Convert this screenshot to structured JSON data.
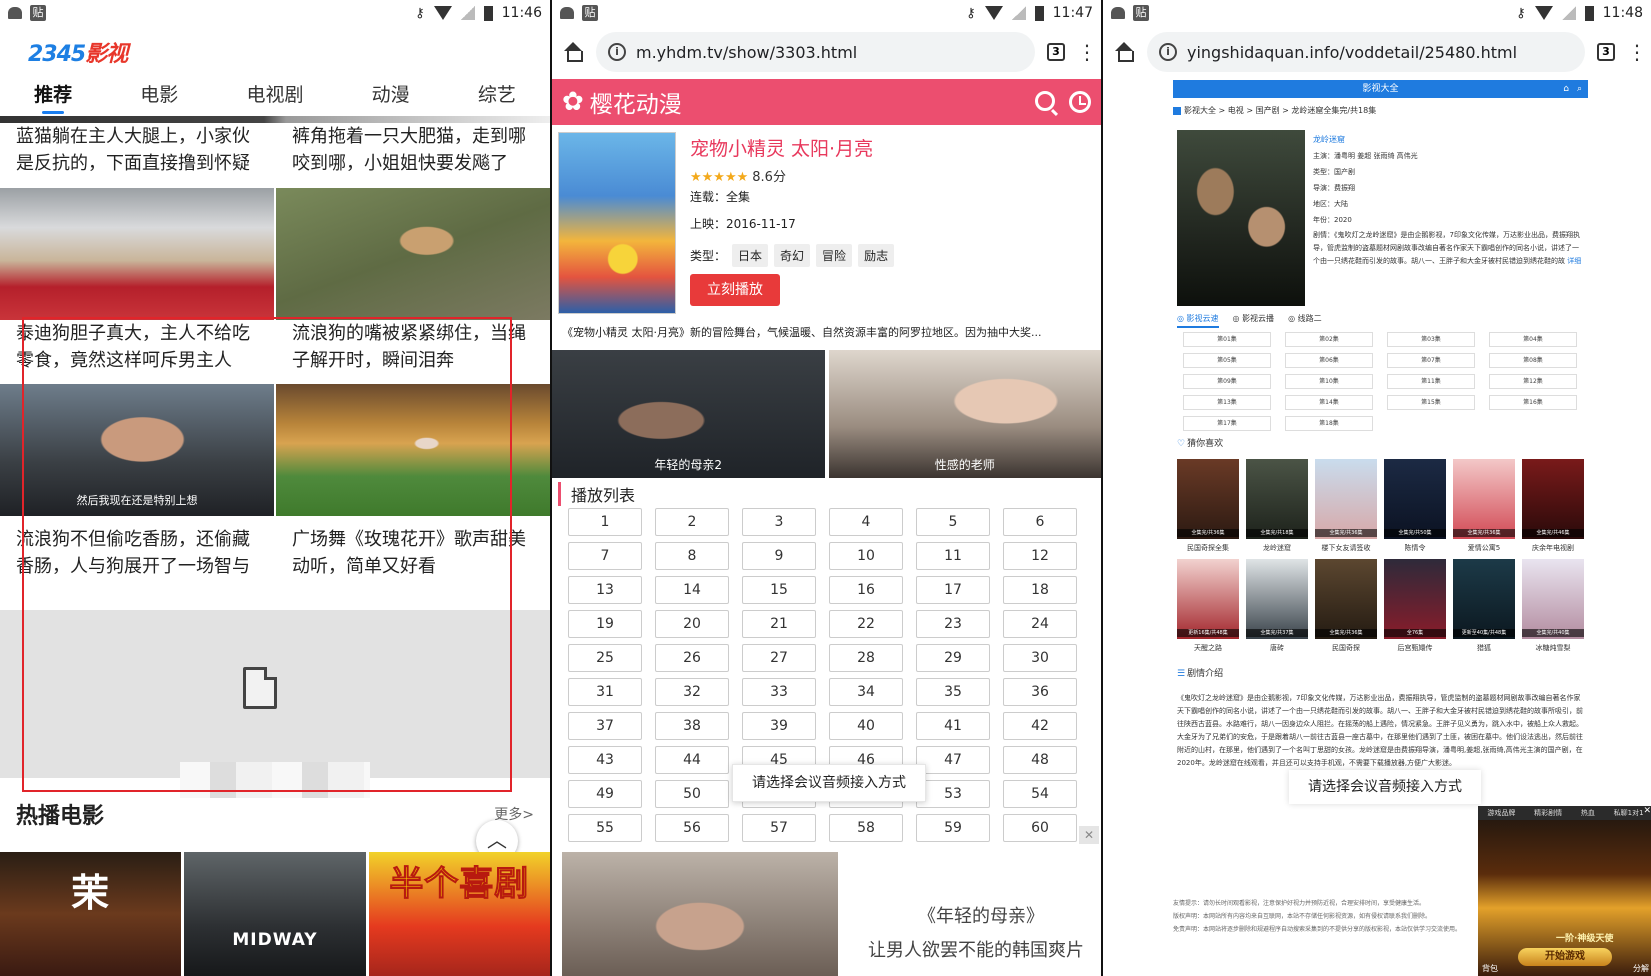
{
  "screen1": {
    "status": {
      "time": "11:46",
      "app_badge": "贴"
    },
    "logo": {
      "digits": "2345",
      "text": "影视"
    },
    "tabs": [
      {
        "label": "推荐",
        "active": true
      },
      {
        "label": "电影",
        "active": false
      },
      {
        "label": "电视剧",
        "active": false
      },
      {
        "label": "动漫",
        "active": false
      },
      {
        "label": "综艺",
        "active": false
      }
    ],
    "feed": [
      {
        "title": "蓝猫躺在主人大腿上，小家伙是反抗的，下面直接撸到怀疑"
      },
      {
        "title": "裤角拖着一只大肥猫，走到哪咬到哪，小姐姐快要发飚了"
      },
      {
        "title": "泰迪狗胆子真大，主人不给吃零食，竟然这样呵斥男主人"
      },
      {
        "title": "流浪狗的嘴被紧紧绑住，当绳子解开时，瞬间泪奔"
      },
      {
        "title": "流浪狗不但偷吃香肠，还偷藏香肠，人与狗展开了一场智与",
        "image_caption": "然后我现在还是特别上想"
      },
      {
        "title": "广场舞《玫瑰花开》歌声甜美动听，简单又好看"
      }
    ],
    "hot_section": {
      "title": "热播电影",
      "more": "更多>"
    },
    "posters": [
      {
        "title": "茉",
        "color": "#3a1a12"
      },
      {
        "title": "MIDWAY",
        "color": "#2d3033"
      },
      {
        "title": "半个喜剧",
        "color": "#e53a1f"
      }
    ]
  },
  "screen2": {
    "status": {
      "time": "11:47",
      "app_badge": "贴"
    },
    "url": "m.yhdm.tv/show/3303.html",
    "tab_count": "3",
    "brand": "樱花动漫",
    "brand_color": "#ec4e6f",
    "title": "宠物小精灵 太阳·月亮",
    "stars": "★★★★★",
    "score": "8.6分",
    "serial": "连载：全集",
    "release": "上映：2016-11-17",
    "type_label": "类型：",
    "tags": [
      "日本",
      "奇幻",
      "冒险",
      "励志"
    ],
    "play_button": "立刻播放",
    "description": "《宠物小精灵 太阳·月亮》新的冒险舞台，气候温暖、自然资源丰富的阿罗拉地区。因为抽中大奖...",
    "ads": [
      {
        "caption": "年轻的母亲2"
      },
      {
        "caption": "性感的老师"
      }
    ],
    "playlist_heading": "播放列表",
    "episodes": [
      "1",
      "2",
      "3",
      "4",
      "5",
      "6",
      "7",
      "8",
      "9",
      "10",
      "11",
      "12",
      "13",
      "14",
      "15",
      "16",
      "17",
      "18",
      "19",
      "20",
      "21",
      "22",
      "23",
      "24",
      "25",
      "26",
      "27",
      "28",
      "29",
      "30",
      "31",
      "32",
      "33",
      "34",
      "35",
      "36",
      "37",
      "38",
      "39",
      "40",
      "41",
      "42",
      "43",
      "44",
      "45",
      "46",
      "47",
      "48",
      "49",
      "50",
      "51",
      "52",
      "53",
      "54",
      "55",
      "56",
      "57",
      "58",
      "59",
      "60"
    ],
    "toast": "请选择会议音频接入方式",
    "bottom_ad": {
      "line1": "《年轻的母亲》",
      "line2": "让男人欲罢不能的韩国爽片"
    }
  },
  "screen3": {
    "status": {
      "time": "11:48",
      "app_badge": "贴"
    },
    "url": "yingshidaquan.info/voddetail/25480.html",
    "tab_count": "3",
    "site_title": "影视大全",
    "breadcrumb": "影视大全 > 电视 > 国产剧 > 龙岭迷窟全集完/共18集",
    "info": {
      "name": "龙岭迷窟",
      "cast": "主演：潘粤明 姜超 张雨绮 高伟光",
      "category": "类型：国产剧",
      "director": "导演：费振翔",
      "region": "地区：大陆",
      "year": "年份：2020",
      "synopsis": "剧情：《鬼吹灯之龙岭迷窟》是由企鹅影视，7印象文化传媒，万达影业出品，费振翔执导，管虎监制的盗墓题材网剧故事改编自著名作家天下霸唱创作的同名小说，讲述了一个由一只绣花鞋而引发的故事。胡八一、王胖子和大金牙被村民错迫到绣花鞋的故",
      "more": "详细"
    },
    "sources": [
      {
        "label": "影视云速",
        "active": true
      },
      {
        "label": "影视云播",
        "active": false
      },
      {
        "label": "线路二",
        "active": false
      }
    ],
    "episodes": [
      "第01集",
      "第02集",
      "第03集",
      "第04集",
      "第05集",
      "第06集",
      "第07集",
      "第08集",
      "第09集",
      "第10集",
      "第11集",
      "第12集",
      "第13集",
      "第14集",
      "第15集",
      "第16集",
      "第17集",
      "第18集"
    ],
    "recs_heading": "猜你喜欢",
    "recs": [
      {
        "name": "民国奇探全集",
        "badge": "全集完/共36集"
      },
      {
        "name": "龙岭迷窟",
        "badge": "全集完/共18集"
      },
      {
        "name": "楼下女友请签收",
        "badge": "全集完/共36集"
      },
      {
        "name": "陈情令",
        "badge": "全集完/共50集"
      },
      {
        "name": "爱情公寓5",
        "badge": "全集完/共36集"
      },
      {
        "name": "庆余年电视剧",
        "badge": "全集完/共46集"
      },
      {
        "name": "天醒之路",
        "badge": "更新16集/共48集"
      },
      {
        "name": "唐砖",
        "badge": "全集完/共37集"
      },
      {
        "name": "民国奇探",
        "badge": "全集完/共36集"
      },
      {
        "name": "后宫甄嬛传",
        "badge": "全76集"
      },
      {
        "name": "猎狐",
        "badge": "更新至40集/共48集"
      },
      {
        "name": "冰糖炖雪梨",
        "badge": "全集完/共40集"
      }
    ],
    "plot_heading": "剧情介绍",
    "plot": "《鬼吹灯之龙岭迷窟》是由企鹅影视，7印象文化传媒，万达影业出品，费振翔执导，管虎监制的盗墓题材网剧故事改编自著名作家天下霸唱创作的同名小说，讲述了一个由一只绣花鞋而引发的故事。胡八一、王胖子和大金牙被村民错迫到绣花鞋的故事所吸引，前往陕西古蓝县。水路难行，胡八一因身边众人阻拦。在摇荡的船上遇险，情况紧急。王胖子见义勇为，跳入水中，被船上众人救起。大金牙为了兄弟们的安危，于是跟着胡八一前往古蓝县一座古墓中，在那里他们遇到了土匪，被困在墓中。他们设法逃出，然后前往附近的山村，在那里，他们遇到了一个名叫丁思甜的女孩。龙岭迷窟是由费振翔导演，潘粤明,姜超,张雨绮,高伟光主演的国产剧，在2020年。龙岭迷窟在线观看，并且还可以支持手机观，不需要下载播放器,方便广大影迷。",
    "toast": "请选择会议音频接入方式",
    "footer": [
      "友情提示：请勿长时间观看影视，注意保护好视力并预防近视，合理安排时间，享受健康生活。",
      "版权声明：本网站所有内容均来自互联网，本站不存储任何影视资源，如有侵权请联系我们删除。",
      "免责声明：本网站将逐步删除和规避程序自动搜索采集到的不提供分享的版权影视，本站仅供学习交流使用。"
    ],
    "game_ad": {
      "tabs": [
        "游戏品牌",
        "精彩剧情",
        "热血",
        "私聊1对1"
      ],
      "slogan": "一阶·神级天使",
      "cta": "开始游戏",
      "left": "背包",
      "right": "分解"
    }
  }
}
